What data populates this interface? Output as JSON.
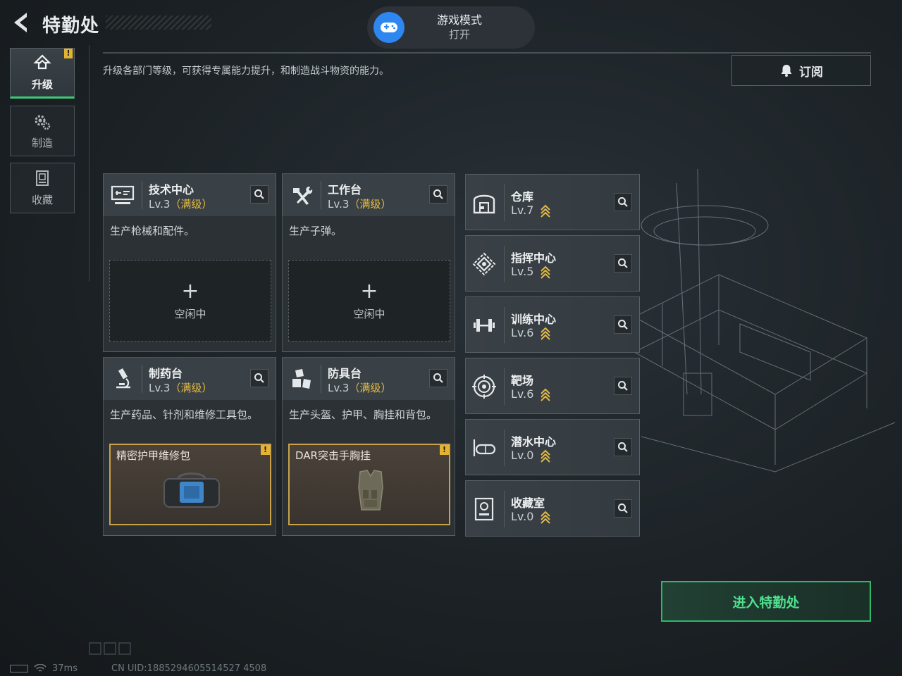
{
  "header": {
    "title": "特勤处",
    "game_mode": {
      "label": "游戏模式",
      "status": "打开"
    }
  },
  "description": "升级各部门等级，可获得专属能力提升，和制造战斗物资的能力。",
  "subscribe_label": "订阅",
  "sidebar": {
    "tabs": [
      {
        "label": "升级",
        "icon": "upgrade-icon",
        "active": true,
        "badge": "!"
      },
      {
        "label": "制造",
        "icon": "gears-icon",
        "active": false
      },
      {
        "label": "收藏",
        "icon": "collection-icon",
        "active": false
      }
    ]
  },
  "workshops": [
    {
      "name": "技术中心",
      "level": "Lv.3",
      "max_label": "（满级）",
      "desc": "生产枪械和配件。",
      "slot": {
        "type": "idle",
        "label": "空闲中",
        "plus": "+"
      },
      "icon": "monitor-icon"
    },
    {
      "name": "工作台",
      "level": "Lv.3",
      "max_label": "（满级）",
      "desc": "生产子弹。",
      "slot": {
        "type": "idle",
        "label": "空闲中",
        "plus": "+"
      },
      "icon": "hammer-wrench-icon"
    },
    {
      "name": "制药台",
      "level": "Lv.3",
      "max_label": "（满级）",
      "desc": "生产药品、针剂和维修工具包。",
      "slot": {
        "type": "item",
        "label": "精密护甲维修包",
        "badge": "!"
      },
      "icon": "microscope-icon"
    },
    {
      "name": "防具台",
      "level": "Lv.3",
      "max_label": "（满级）",
      "desc": "生产头盔、护甲、胸挂和背包。",
      "slot": {
        "type": "item",
        "label": "DAR突击手胸挂",
        "badge": "!"
      },
      "icon": "armor-pieces-icon"
    }
  ],
  "facilities": [
    {
      "name": "仓库",
      "level": "Lv.7",
      "icon": "warehouse-icon",
      "upgradable": true
    },
    {
      "name": "指挥中心",
      "level": "Lv.5",
      "icon": "command-icon",
      "upgradable": true
    },
    {
      "name": "训练中心",
      "level": "Lv.6",
      "icon": "dumbbell-icon",
      "upgradable": true
    },
    {
      "name": "靶场",
      "level": "Lv.6",
      "icon": "target-icon",
      "upgradable": true
    },
    {
      "name": "潜水中心",
      "level": "Lv.0",
      "icon": "diving-mask-icon",
      "upgradable": true
    },
    {
      "name": "收藏室",
      "level": "Lv.0",
      "icon": "collection-room-icon",
      "upgradable": true
    }
  ],
  "enter_button": "进入特勤处",
  "status_bar": {
    "ping": "37ms",
    "uid": "CN UID:1885294605514527 4508"
  },
  "colors": {
    "accent_green": "#3ec97a",
    "max_level_gold": "#e2b944",
    "warning_yellow": "#e3b331",
    "game_mode_blue": "#2e86f0"
  }
}
